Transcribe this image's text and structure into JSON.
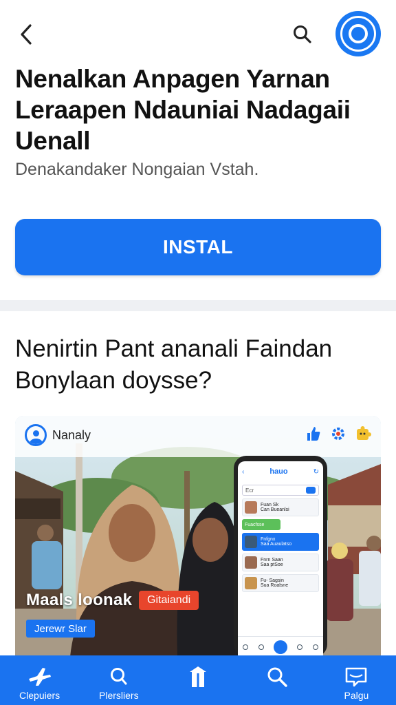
{
  "header": {
    "title": "Nenalkan Anpagen Yarnan Leraapen Ndauniai Nadagaii Uenall",
    "subtitle": "Denakandaker Nongaian Vstah."
  },
  "install": {
    "label": "INSTAL"
  },
  "section": {
    "title": "Nenirtin Pant ananali Faindan Bonylaan doysse?"
  },
  "media": {
    "username": "Nanaly",
    "caption_title": "Maals loonak",
    "caption_tag": "Gitaiandi",
    "caption_sub": "Jerewr Slar",
    "phone": {
      "title": "hauo",
      "search_text": "Ecr",
      "rows": [
        {
          "line1": "Fuan Sk",
          "line2": "Can Bueanlsi"
        },
        {
          "line1": "Fuacfsse",
          "line2": ""
        },
        {
          "line1": "Fnfgnx",
          "line2": "Saa Auaulatso"
        },
        {
          "line1": "Fnrn Saan",
          "line2": "Saa ptSoe"
        },
        {
          "line1": "Fu- Sagsin",
          "line2": "Sua Roalsne"
        }
      ]
    }
  },
  "bottom_nav": [
    {
      "label": "Clepuiers",
      "icon": "plane-icon"
    },
    {
      "label": "Plersliers",
      "icon": "search-icon"
    },
    {
      "label": "",
      "icon": "upload-box-icon"
    },
    {
      "label": "",
      "icon": "magnifier-icon"
    },
    {
      "label": "Palgu",
      "icon": "chat-icon"
    }
  ],
  "colors": {
    "accent": "#1a73f0",
    "tag": "#e8452c",
    "text": "#111111",
    "subtitle": "#555555"
  }
}
